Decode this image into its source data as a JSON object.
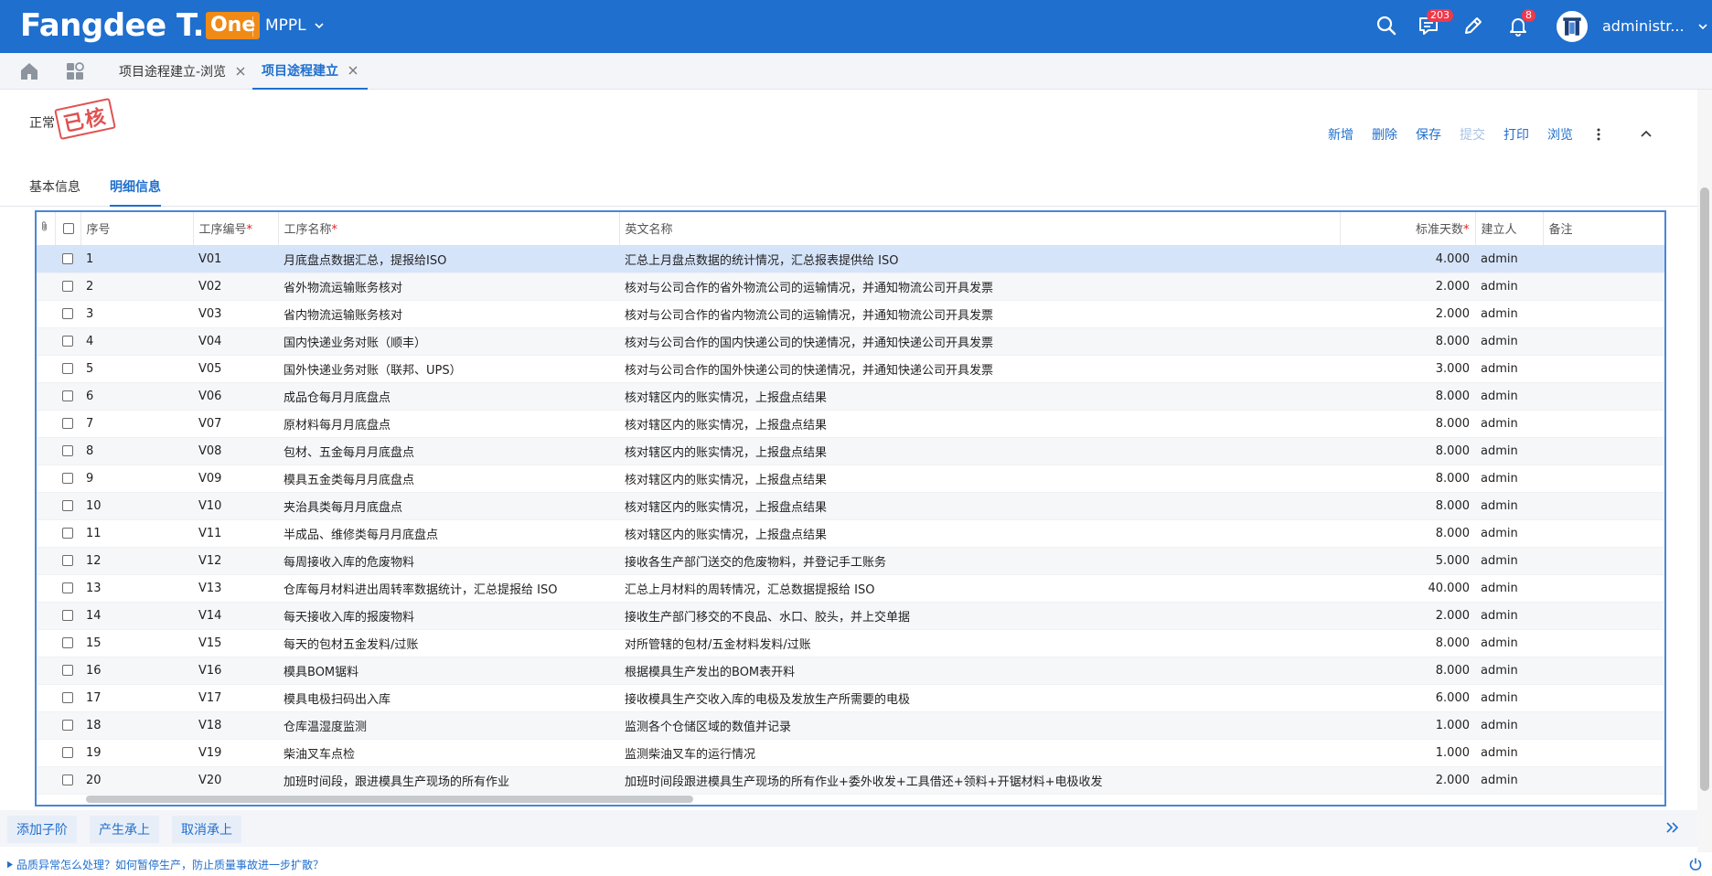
{
  "header": {
    "brand": "Fangdee T.",
    "brand_suffix": "One",
    "org": "MPPL",
    "messages_badge": "203",
    "notifications_badge": "8",
    "user": "administr..."
  },
  "tabs": [
    {
      "label": "项目途程建立-浏览"
    },
    {
      "label": "项目途程建立"
    }
  ],
  "status": {
    "state": "正常",
    "stamp": "已核"
  },
  "actions": {
    "new": "新增",
    "delete": "删除",
    "save": "保存",
    "submit": "提交",
    "print": "打印",
    "browse": "浏览"
  },
  "subtabs": [
    {
      "label": "基本信息"
    },
    {
      "label": "明细信息"
    }
  ],
  "grid": {
    "columns": {
      "seq": "序号",
      "code": "工序编号",
      "name": "工序名称",
      "en_name": "英文名称",
      "days": "标准天数",
      "creator": "建立人",
      "remark": "备注"
    },
    "required_mark": "*",
    "rows": [
      {
        "seq": "1",
        "code": "V01",
        "name": "月底盘点数据汇总，提报给ISO",
        "en": "汇总上月盘点数据的统计情况，汇总报表提供给 ISO",
        "days": "4.000",
        "creator": "admin"
      },
      {
        "seq": "2",
        "code": "V02",
        "name": "省外物流运输账务核对",
        "en": "核对与公司合作的省外物流公司的运输情况，并通知物流公司开具发票",
        "days": "2.000",
        "creator": "admin"
      },
      {
        "seq": "3",
        "code": "V03",
        "name": "省内物流运输账务核对",
        "en": "核对与公司合作的省内物流公司的运输情况，并通知物流公司开具发票",
        "days": "2.000",
        "creator": "admin"
      },
      {
        "seq": "4",
        "code": "V04",
        "name": "国内快递业务对账（顺丰）",
        "en": "核对与公司合作的国内快递公司的快递情况，并通知快递公司开具发票",
        "days": "8.000",
        "creator": "admin"
      },
      {
        "seq": "5",
        "code": "V05",
        "name": "国外快递业务对账（联邦、UPS）",
        "en": "核对与公司合作的国外快递公司的快递情况，并通知快递公司开具发票",
        "days": "3.000",
        "creator": "admin"
      },
      {
        "seq": "6",
        "code": "V06",
        "name": "成品仓每月月底盘点",
        "en": "核对辖区内的账实情况，上报盘点结果",
        "days": "8.000",
        "creator": "admin"
      },
      {
        "seq": "7",
        "code": "V07",
        "name": "原材料每月月底盘点",
        "en": "核对辖区内的账实情况，上报盘点结果",
        "days": "8.000",
        "creator": "admin"
      },
      {
        "seq": "8",
        "code": "V08",
        "name": "包材、五金每月月底盘点",
        "en": "核对辖区内的账实情况，上报盘点结果",
        "days": "8.000",
        "creator": "admin"
      },
      {
        "seq": "9",
        "code": "V09",
        "name": "模具五金类每月月底盘点",
        "en": "核对辖区内的账实情况，上报盘点结果",
        "days": "8.000",
        "creator": "admin"
      },
      {
        "seq": "10",
        "code": "V10",
        "name": "夹治具类每月月底盘点",
        "en": "核对辖区内的账实情况，上报盘点结果",
        "days": "8.000",
        "creator": "admin"
      },
      {
        "seq": "11",
        "code": "V11",
        "name": "半成品、维修类每月月底盘点",
        "en": "核对辖区内的账实情况，上报盘点结果",
        "days": "8.000",
        "creator": "admin"
      },
      {
        "seq": "12",
        "code": "V12",
        "name": "每周接收入库的危废物料",
        "en": "接收各生产部门送交的危废物料，并登记手工账务",
        "days": "5.000",
        "creator": "admin"
      },
      {
        "seq": "13",
        "code": "V13",
        "name": "仓库每月材料进出周转率数据统计，汇总提报给 ISO",
        "en": "汇总上月材料的周转情况，汇总数据提报给 ISO",
        "days": "40.000",
        "creator": "admin"
      },
      {
        "seq": "14",
        "code": "V14",
        "name": "每天接收入库的报废物料",
        "en": "接收生产部门移交的不良品、水口、胶头，并上交单据",
        "days": "2.000",
        "creator": "admin"
      },
      {
        "seq": "15",
        "code": "V15",
        "name": "每天的包材五金发料/过账",
        "en": "对所管辖的包材/五金材料发料/过账",
        "days": "8.000",
        "creator": "admin"
      },
      {
        "seq": "16",
        "code": "V16",
        "name": "模具BOM锯料",
        "en": "根据模具生产发出的BOM表开料",
        "days": "8.000",
        "creator": "admin"
      },
      {
        "seq": "17",
        "code": "V17",
        "name": "模具电极扫码出入库",
        "en": "接收模具生产交收入库的电极及发放生产所需要的电极",
        "days": "6.000",
        "creator": "admin"
      },
      {
        "seq": "18",
        "code": "V18",
        "name": "仓库温湿度监测",
        "en": "监测各个仓储区域的数值并记录",
        "days": "1.000",
        "creator": "admin"
      },
      {
        "seq": "19",
        "code": "V19",
        "name": "柴油叉车点检",
        "en": "监测柴油叉车的运行情况",
        "days": "1.000",
        "creator": "admin"
      },
      {
        "seq": "20",
        "code": "V20",
        "name": "加班时间段，跟进模具生产现场的所有作业",
        "en": "加班时间段跟进模具生产现场的所有作业+委外收发+工具借还+领料+开锯材料+电极收发",
        "days": "2.000",
        "creator": "admin"
      }
    ]
  },
  "bottom_buttons": {
    "add_child": "添加子阶",
    "produce_inherit": "产生承上",
    "cancel_inherit": "取消承上"
  },
  "footer": {
    "tip": "品质异常怎么处理？如何暂停生产，防止质量事故进一步扩散？"
  },
  "colors": {
    "brand_blue": "#1f6fce",
    "brand_orange": "#f08a16",
    "stamp_red": "#e05252",
    "selected_row": "#d6e4fa"
  }
}
